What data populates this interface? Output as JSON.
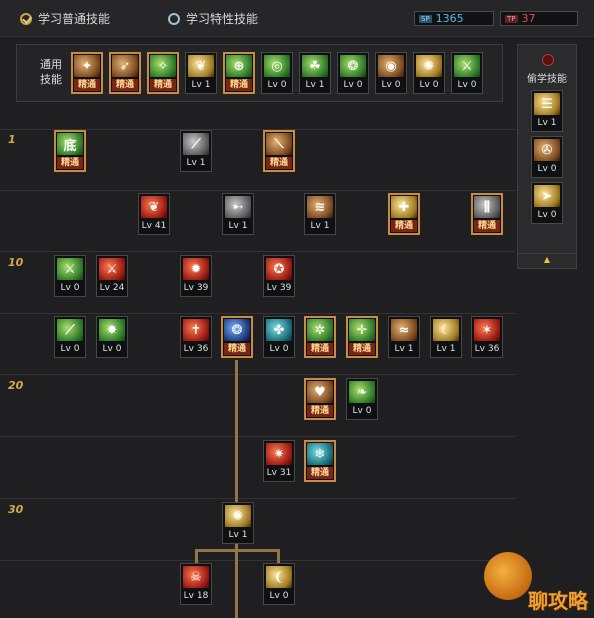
{
  "tabs": [
    {
      "label": "学习普通技能",
      "checked": true
    },
    {
      "label": "学习特性技能",
      "checked": false
    }
  ],
  "points": {
    "sp": {
      "icon": "SP",
      "value": "1365"
    },
    "tp": {
      "icon": "TP",
      "value": "37"
    }
  },
  "common": {
    "label": "通用技能",
    "skills": [
      {
        "icon": "run-icon",
        "glyph": "✦",
        "level": "精通",
        "mastered": true,
        "color": "brown"
      },
      {
        "icon": "dash-icon",
        "glyph": "➶",
        "level": "精通",
        "mastered": true,
        "color": "brown"
      },
      {
        "icon": "strike-icon",
        "glyph": "✧",
        "level": "精通",
        "mastered": true,
        "color": "green"
      },
      {
        "icon": "wings-icon",
        "glyph": "❦",
        "level": "Lv 1",
        "mastered": false,
        "color": "gold"
      },
      {
        "icon": "crosshair-icon",
        "glyph": "⊕",
        "level": "精通",
        "mastered": true,
        "color": "green"
      },
      {
        "icon": "target-icon",
        "glyph": "◎",
        "level": "Lv 0",
        "mastered": false,
        "color": "green"
      },
      {
        "icon": "spirit-icon",
        "glyph": "☘",
        "level": "Lv 1",
        "mastered": false,
        "color": "green"
      },
      {
        "icon": "aura-icon",
        "glyph": "❂",
        "level": "Lv 0",
        "mastered": false,
        "color": "green"
      },
      {
        "icon": "eye-icon",
        "glyph": "◉",
        "level": "Lv 0",
        "mastered": false,
        "color": "brown"
      },
      {
        "icon": "buff-icon",
        "glyph": "✺",
        "level": "Lv 0",
        "mastered": false,
        "color": "gold"
      },
      {
        "icon": "blade-icon",
        "glyph": "⚔",
        "level": "Lv 0",
        "mastered": false,
        "color": "green"
      }
    ]
  },
  "steal": {
    "label": "偷学技能",
    "skills": [
      {
        "icon": "sequence-icon",
        "glyph": "☰",
        "level": "Lv 1",
        "mastered": false,
        "color": "gold"
      },
      {
        "icon": "vortex-icon",
        "glyph": "✇",
        "level": "Lv 0",
        "mastered": false,
        "color": "brown"
      },
      {
        "icon": "arrow-icon",
        "glyph": "➤",
        "level": "Lv 0",
        "mastered": false,
        "color": "gold"
      }
    ],
    "collapse": "▲"
  },
  "levels": [
    "1",
    "10",
    "20",
    "30"
  ],
  "tree": [
    {
      "icon": "bottom-icon",
      "glyph": "底",
      "level": "精通",
      "mastered": true,
      "color": "green"
    },
    {
      "icon": "claw-icon",
      "glyph": "⟋",
      "level": "Lv 1",
      "mastered": false,
      "color": "grey"
    },
    {
      "icon": "slash-icon",
      "glyph": "⟍",
      "level": "精通",
      "mastered": true,
      "color": "brown"
    },
    {
      "icon": "wing-burst-icon",
      "glyph": "❦",
      "level": "Lv 41",
      "mastered": false,
      "color": "red"
    },
    {
      "icon": "pierce-icon",
      "glyph": "➸",
      "level": "Lv 1",
      "mastered": false,
      "color": "grey"
    },
    {
      "icon": "shockwave-icon",
      "glyph": "≋",
      "level": "Lv 1",
      "mastered": false,
      "color": "brown"
    },
    {
      "icon": "shield-icon",
      "glyph": "✚",
      "level": "精通",
      "mastered": true,
      "color": "gold"
    },
    {
      "icon": "triple-blade-icon",
      "glyph": "⫼",
      "level": "精通",
      "mastered": true,
      "color": "grey"
    },
    {
      "icon": "sword-icon",
      "glyph": "⚔",
      "level": "Lv 0",
      "mastered": false,
      "color": "green"
    },
    {
      "icon": "red-sword-icon",
      "glyph": "⚔",
      "level": "Lv 24",
      "mastered": false,
      "color": "red"
    },
    {
      "icon": "flame-icon",
      "glyph": "✹",
      "level": "Lv 39",
      "mastered": false,
      "color": "red"
    },
    {
      "icon": "whirl-icon",
      "glyph": "✪",
      "level": "Lv 39",
      "mastered": false,
      "color": "red"
    },
    {
      "icon": "greatsword-icon",
      "glyph": "⟋",
      "level": "Lv 0",
      "mastered": false,
      "color": "green"
    },
    {
      "icon": "burst-icon",
      "glyph": "✸",
      "level": "Lv 0",
      "mastered": false,
      "color": "green"
    },
    {
      "icon": "cross-icon",
      "glyph": "✝",
      "level": "Lv 36",
      "mastered": false,
      "color": "red"
    },
    {
      "icon": "orb-icon",
      "glyph": "❂",
      "level": "精通",
      "mastered": true,
      "color": "blue"
    },
    {
      "icon": "sigil-icon",
      "glyph": "✤",
      "level": "Lv 0",
      "mastered": false,
      "color": "teal"
    },
    {
      "icon": "beast-icon",
      "glyph": "✲",
      "level": "精通",
      "mastered": true,
      "color": "green"
    },
    {
      "icon": "holy-cross-icon",
      "glyph": "✛",
      "level": "精通",
      "mastered": true,
      "color": "green"
    },
    {
      "icon": "wave-icon",
      "glyph": "≈",
      "level": "Lv 1",
      "mastered": false,
      "color": "brown"
    },
    {
      "icon": "crescent-icon",
      "glyph": "☾",
      "level": "Lv 1",
      "mastered": false,
      "color": "gold"
    },
    {
      "icon": "fire-slash-icon",
      "glyph": "✶",
      "level": "Lv 36",
      "mastered": false,
      "color": "red"
    },
    {
      "icon": "heart-shield-icon",
      "glyph": "♥",
      "level": "精通",
      "mastered": true,
      "color": "brown"
    },
    {
      "icon": "vine-icon",
      "glyph": "❧",
      "level": "Lv 0",
      "mastered": false,
      "color": "green"
    },
    {
      "icon": "spike-icon",
      "glyph": "✷",
      "level": "Lv 31",
      "mastered": false,
      "color": "red"
    },
    {
      "icon": "frost-icon",
      "glyph": "❄",
      "level": "精通",
      "mastered": true,
      "color": "teal"
    },
    {
      "icon": "star-burst-icon",
      "glyph": "✺",
      "level": "Lv 1",
      "mastered": false,
      "color": "gold"
    },
    {
      "icon": "demon-icon",
      "glyph": "☠",
      "level": "Lv 18",
      "mastered": false,
      "color": "red"
    },
    {
      "icon": "horn-icon",
      "glyph": "❨",
      "level": "Lv 0",
      "mastered": false,
      "color": "gold"
    }
  ],
  "watermark": {
    "text": "聊攻略"
  }
}
